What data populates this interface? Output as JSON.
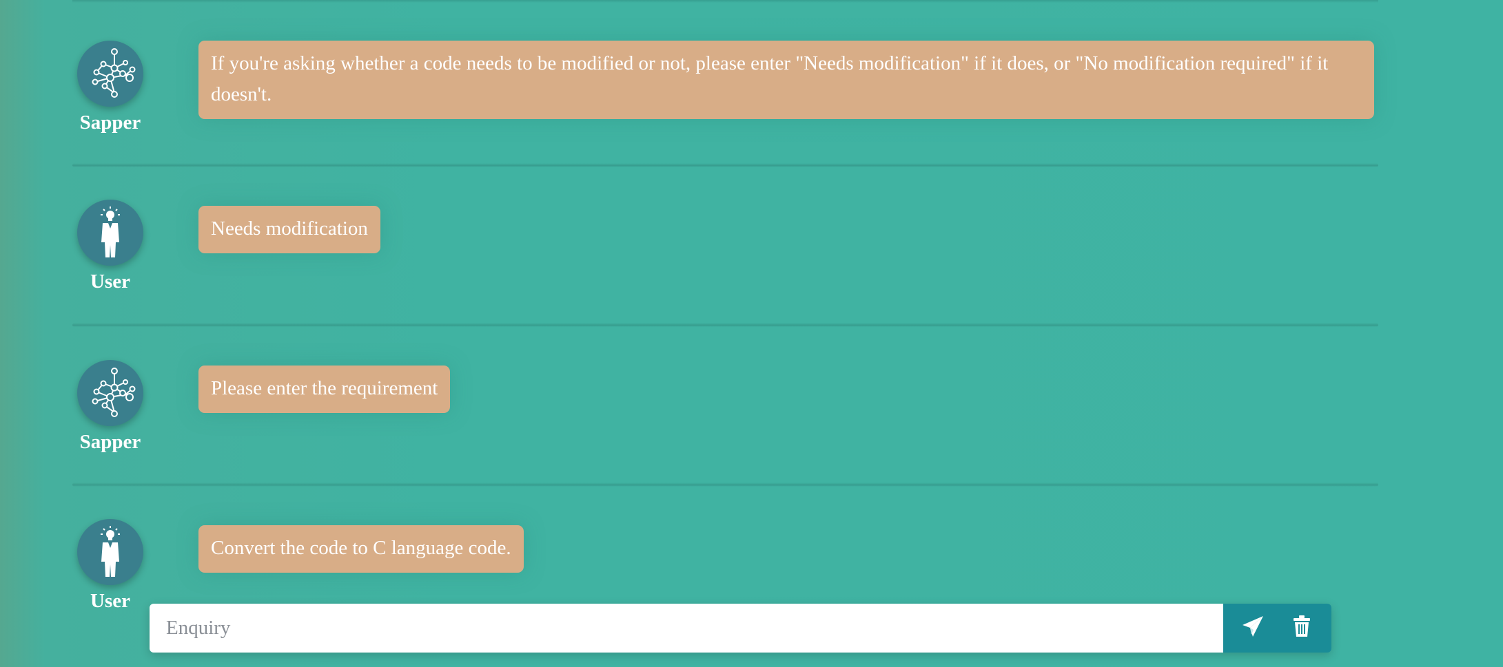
{
  "messages": [
    {
      "role": "Sapper",
      "avatar_icon": "network-graph-icon",
      "text": "If you're asking whether a code needs to be modified or not, please enter \"Needs modification\" if it does, or \"No modification required\" if it doesn't."
    },
    {
      "role": "User",
      "avatar_icon": "user-lightbulb-icon",
      "text": "Needs modification"
    },
    {
      "role": "Sapper",
      "avatar_icon": "network-graph-icon",
      "text": "Please enter the requirement"
    },
    {
      "role": "User",
      "avatar_icon": "user-lightbulb-icon",
      "text": "Convert the code to C language code."
    }
  ],
  "input": {
    "placeholder": "Enquiry",
    "value": ""
  },
  "buttons": {
    "send_icon": "send-icon",
    "clear_icon": "trash-icon"
  },
  "colors": {
    "background": "#40b3a2",
    "bubble": "#d8ad87",
    "avatar": "#3a7f8d",
    "button_group": "#1a8c97"
  }
}
